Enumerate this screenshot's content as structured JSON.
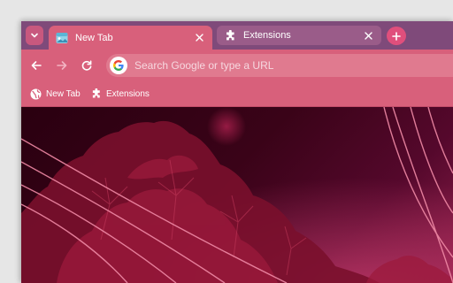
{
  "tabs": [
    {
      "title": "New Tab",
      "active": true,
      "favicon": "new-tab-favicon-icon"
    },
    {
      "title": "Extensions",
      "active": false,
      "favicon": "puzzle-icon"
    }
  ],
  "omnibox": {
    "placeholder": "Search Google or type a URL",
    "value": ""
  },
  "bookmarks": [
    {
      "label": "New Tab",
      "icon": "globe-icon"
    },
    {
      "label": "Extensions",
      "icon": "puzzle-icon"
    }
  ],
  "colors": {
    "frame": "#7f4a7a",
    "toolbar": "#d8607b",
    "omnibox": "#e07a8f",
    "new_tab_button": "#e04f7c",
    "inactive_tab": "#9a5c89"
  }
}
